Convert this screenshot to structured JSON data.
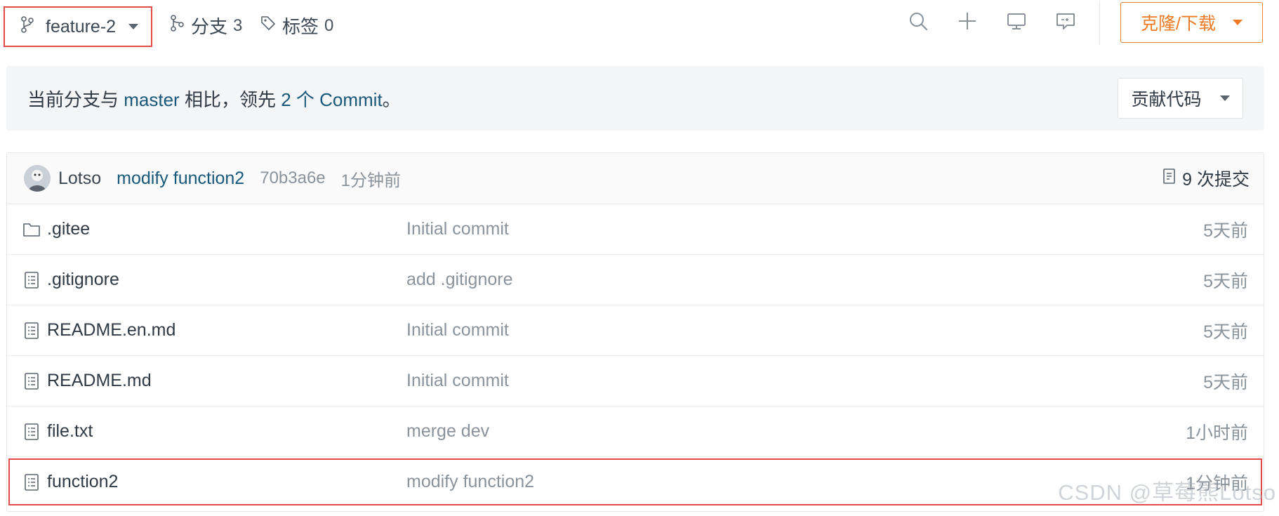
{
  "topbar": {
    "branch_name": "feature-2",
    "branches_label": "分支",
    "branches_count": "3",
    "tags_label": "标签",
    "tags_count": "0",
    "clone_label": "克隆/下载",
    "icons": [
      "search-icon",
      "plus-icon",
      "monitor-icon",
      "chat-icon"
    ]
  },
  "compare": {
    "prefix": "当前分支与",
    "base_branch": "master",
    "middle": "相比，领先",
    "ahead_count": "2",
    "suffix_pre": "个 Commit",
    "suffix": "。",
    "contribute_label": "贡献代码"
  },
  "latest_commit": {
    "author": "Lotso",
    "message": "modify function2",
    "sha": "70b3a6e",
    "time": "1分钟前",
    "commit_count_label": "9 次提交"
  },
  "files": [
    {
      "name": ".gitee",
      "type": "folder",
      "message": "Initial commit",
      "time": "5天前"
    },
    {
      "name": ".gitignore",
      "type": "file",
      "message": "add .gitignore",
      "time": "5天前"
    },
    {
      "name": "README.en.md",
      "type": "file",
      "message": "Initial commit",
      "time": "5天前"
    },
    {
      "name": "README.md",
      "type": "file",
      "message": "Initial commit",
      "time": "5天前"
    },
    {
      "name": "file.txt",
      "type": "file",
      "message": "merge dev",
      "time": "1小时前"
    },
    {
      "name": "function2",
      "type": "file",
      "message": "modify function2",
      "time": "1分钟前"
    }
  ],
  "colors": {
    "accent_orange": "#ef7a26",
    "link_blue": "#18587b",
    "highlight_red": "#e34b4b"
  },
  "watermark": "CSDN @草莓熊Lotso"
}
